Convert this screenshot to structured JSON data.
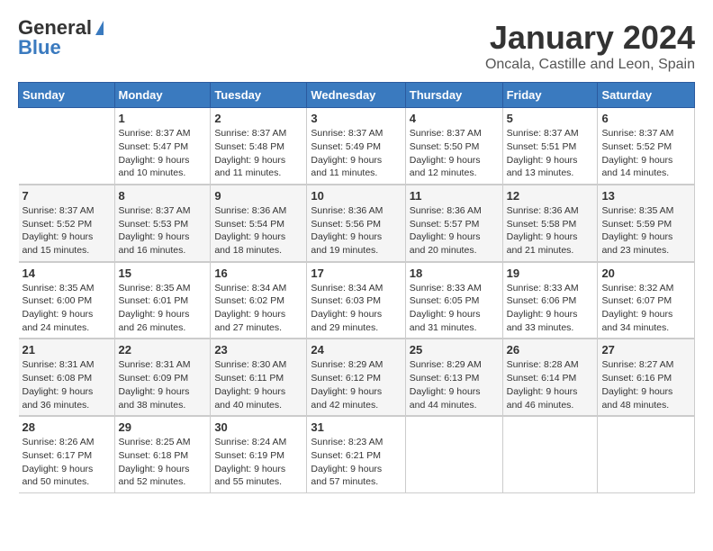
{
  "header": {
    "logo_general": "General",
    "logo_blue": "Blue",
    "month": "January 2024",
    "location": "Oncala, Castille and Leon, Spain"
  },
  "weekdays": [
    "Sunday",
    "Monday",
    "Tuesday",
    "Wednesday",
    "Thursday",
    "Friday",
    "Saturday"
  ],
  "weeks": [
    [
      {
        "day": "",
        "info": ""
      },
      {
        "day": "1",
        "info": "Sunrise: 8:37 AM\nSunset: 5:47 PM\nDaylight: 9 hours\nand 10 minutes."
      },
      {
        "day": "2",
        "info": "Sunrise: 8:37 AM\nSunset: 5:48 PM\nDaylight: 9 hours\nand 11 minutes."
      },
      {
        "day": "3",
        "info": "Sunrise: 8:37 AM\nSunset: 5:49 PM\nDaylight: 9 hours\nand 11 minutes."
      },
      {
        "day": "4",
        "info": "Sunrise: 8:37 AM\nSunset: 5:50 PM\nDaylight: 9 hours\nand 12 minutes."
      },
      {
        "day": "5",
        "info": "Sunrise: 8:37 AM\nSunset: 5:51 PM\nDaylight: 9 hours\nand 13 minutes."
      },
      {
        "day": "6",
        "info": "Sunrise: 8:37 AM\nSunset: 5:52 PM\nDaylight: 9 hours\nand 14 minutes."
      }
    ],
    [
      {
        "day": "7",
        "info": "Sunrise: 8:37 AM\nSunset: 5:52 PM\nDaylight: 9 hours\nand 15 minutes."
      },
      {
        "day": "8",
        "info": "Sunrise: 8:37 AM\nSunset: 5:53 PM\nDaylight: 9 hours\nand 16 minutes."
      },
      {
        "day": "9",
        "info": "Sunrise: 8:36 AM\nSunset: 5:54 PM\nDaylight: 9 hours\nand 18 minutes."
      },
      {
        "day": "10",
        "info": "Sunrise: 8:36 AM\nSunset: 5:56 PM\nDaylight: 9 hours\nand 19 minutes."
      },
      {
        "day": "11",
        "info": "Sunrise: 8:36 AM\nSunset: 5:57 PM\nDaylight: 9 hours\nand 20 minutes."
      },
      {
        "day": "12",
        "info": "Sunrise: 8:36 AM\nSunset: 5:58 PM\nDaylight: 9 hours\nand 21 minutes."
      },
      {
        "day": "13",
        "info": "Sunrise: 8:35 AM\nSunset: 5:59 PM\nDaylight: 9 hours\nand 23 minutes."
      }
    ],
    [
      {
        "day": "14",
        "info": "Sunrise: 8:35 AM\nSunset: 6:00 PM\nDaylight: 9 hours\nand 24 minutes."
      },
      {
        "day": "15",
        "info": "Sunrise: 8:35 AM\nSunset: 6:01 PM\nDaylight: 9 hours\nand 26 minutes."
      },
      {
        "day": "16",
        "info": "Sunrise: 8:34 AM\nSunset: 6:02 PM\nDaylight: 9 hours\nand 27 minutes."
      },
      {
        "day": "17",
        "info": "Sunrise: 8:34 AM\nSunset: 6:03 PM\nDaylight: 9 hours\nand 29 minutes."
      },
      {
        "day": "18",
        "info": "Sunrise: 8:33 AM\nSunset: 6:05 PM\nDaylight: 9 hours\nand 31 minutes."
      },
      {
        "day": "19",
        "info": "Sunrise: 8:33 AM\nSunset: 6:06 PM\nDaylight: 9 hours\nand 33 minutes."
      },
      {
        "day": "20",
        "info": "Sunrise: 8:32 AM\nSunset: 6:07 PM\nDaylight: 9 hours\nand 34 minutes."
      }
    ],
    [
      {
        "day": "21",
        "info": "Sunrise: 8:31 AM\nSunset: 6:08 PM\nDaylight: 9 hours\nand 36 minutes."
      },
      {
        "day": "22",
        "info": "Sunrise: 8:31 AM\nSunset: 6:09 PM\nDaylight: 9 hours\nand 38 minutes."
      },
      {
        "day": "23",
        "info": "Sunrise: 8:30 AM\nSunset: 6:11 PM\nDaylight: 9 hours\nand 40 minutes."
      },
      {
        "day": "24",
        "info": "Sunrise: 8:29 AM\nSunset: 6:12 PM\nDaylight: 9 hours\nand 42 minutes."
      },
      {
        "day": "25",
        "info": "Sunrise: 8:29 AM\nSunset: 6:13 PM\nDaylight: 9 hours\nand 44 minutes."
      },
      {
        "day": "26",
        "info": "Sunrise: 8:28 AM\nSunset: 6:14 PM\nDaylight: 9 hours\nand 46 minutes."
      },
      {
        "day": "27",
        "info": "Sunrise: 8:27 AM\nSunset: 6:16 PM\nDaylight: 9 hours\nand 48 minutes."
      }
    ],
    [
      {
        "day": "28",
        "info": "Sunrise: 8:26 AM\nSunset: 6:17 PM\nDaylight: 9 hours\nand 50 minutes."
      },
      {
        "day": "29",
        "info": "Sunrise: 8:25 AM\nSunset: 6:18 PM\nDaylight: 9 hours\nand 52 minutes."
      },
      {
        "day": "30",
        "info": "Sunrise: 8:24 AM\nSunset: 6:19 PM\nDaylight: 9 hours\nand 55 minutes."
      },
      {
        "day": "31",
        "info": "Sunrise: 8:23 AM\nSunset: 6:21 PM\nDaylight: 9 hours\nand 57 minutes."
      },
      {
        "day": "",
        "info": ""
      },
      {
        "day": "",
        "info": ""
      },
      {
        "day": "",
        "info": ""
      }
    ]
  ]
}
